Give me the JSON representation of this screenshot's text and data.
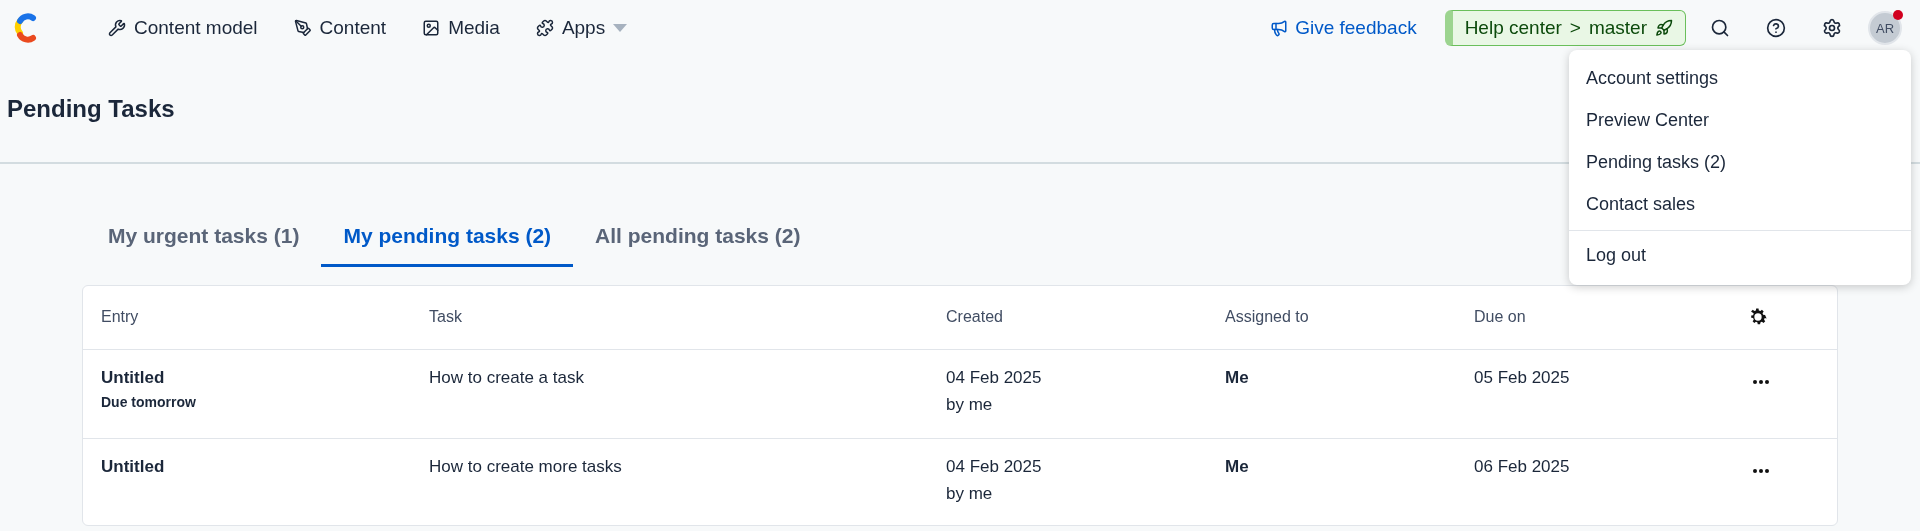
{
  "nav": {
    "items": [
      {
        "label": "Content model",
        "dropdown": false
      },
      {
        "label": "Content",
        "dropdown": false
      },
      {
        "label": "Media",
        "dropdown": false
      },
      {
        "label": "Apps",
        "dropdown": true
      }
    ],
    "feedback": "Give feedback",
    "environment": {
      "space": "Help center",
      "separator": ">",
      "branch": "master"
    },
    "avatar": "AR",
    "notification": true
  },
  "page": {
    "title": "Pending Tasks"
  },
  "tabs": [
    {
      "label": "My urgent tasks (1)",
      "selected": false
    },
    {
      "label": "My pending tasks (2)",
      "selected": true
    },
    {
      "label": "All pending tasks (2)",
      "selected": false
    }
  ],
  "table": {
    "columns": [
      "Entry",
      "Task",
      "Created",
      "Assigned to",
      "Due on"
    ],
    "rows": [
      {
        "entry": "Untitled",
        "note": "Due tomorrow",
        "task": "How to create a task",
        "created": "04 Feb 2025",
        "created_by": "by me",
        "assigned": "Me",
        "due": "05 Feb 2025"
      },
      {
        "entry": "Untitled",
        "task": "How to create more tasks",
        "created": "04 Feb 2025",
        "created_by": "by me",
        "assigned": "Me",
        "due": "06 Feb 2025"
      }
    ]
  },
  "menu": {
    "items": [
      "Account settings",
      "Preview Center",
      "Pending tasks (2)",
      "Contact sales"
    ],
    "footer": [
      "Log out"
    ]
  }
}
